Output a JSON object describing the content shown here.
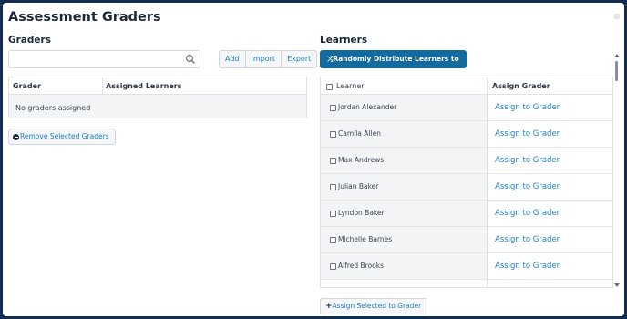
{
  "dialog": {
    "title": "Assessment Graders"
  },
  "graders": {
    "title": "Graders",
    "search": {
      "placeholder": "",
      "value": ""
    },
    "buttons": {
      "add": "Add",
      "import": "Import",
      "export": "Export"
    },
    "table": {
      "columns": [
        "Grader",
        "Assigned Learners"
      ],
      "empty_message": "No graders assigned"
    },
    "remove_button": "Remove Selected Graders"
  },
  "learners": {
    "title": "Learners",
    "distribute_button": "Randomly Distribute Learners to Graders",
    "table": {
      "columns": [
        "Learner",
        "Assign Grader"
      ],
      "rows": [
        {
          "name": "Jordan Alexander",
          "action": "Assign to Grader"
        },
        {
          "name": "Camila Allen",
          "action": "Assign to Grader"
        },
        {
          "name": "Max Andrews",
          "action": "Assign to Grader"
        },
        {
          "name": "Julian Baker",
          "action": "Assign to Grader"
        },
        {
          "name": "Lyndon Baker",
          "action": "Assign to Grader"
        },
        {
          "name": "Michelle Barnes",
          "action": "Assign to Grader"
        },
        {
          "name": "Alfred Brooks",
          "action": "Assign to Grader"
        }
      ]
    },
    "assign_selected_button": "Assign Selected to Grader"
  },
  "colors": {
    "primary": "#126a9e",
    "link": "#1f7fb8",
    "frame": "#0f2e52"
  },
  "icons": [
    "search-icon",
    "minus-circle-icon",
    "shuffle-icon",
    "plus-icon",
    "close-icon"
  ]
}
